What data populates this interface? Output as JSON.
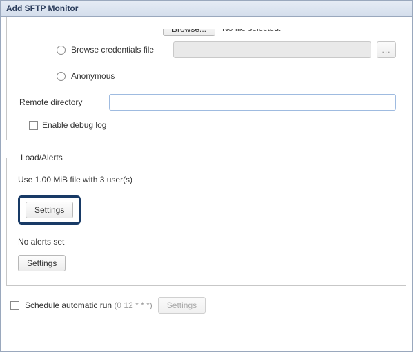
{
  "window": {
    "title": "Add SFTP Monitor"
  },
  "auth": {
    "partial_button_label": "Browse...",
    "partial_status_text": "No file selected.",
    "browse_credentials_label": "Browse credentials file",
    "credentials_value": "",
    "more_button_label": "...",
    "anonymous_label": "Anonymous",
    "remote_dir_label": "Remote directory",
    "remote_dir_value": "",
    "enable_debug_label": "Enable debug log"
  },
  "load_alerts": {
    "legend": "Load/Alerts",
    "use_file_text": "Use 1.00 MiB file with 3 user(s)",
    "settings_btn_1": "Settings",
    "no_alerts_text": "No alerts set",
    "settings_btn_2": "Settings"
  },
  "schedule": {
    "label": "Schedule automatic run ",
    "cron_text": " (0 12 * * *)",
    "settings_btn": "Settings"
  }
}
